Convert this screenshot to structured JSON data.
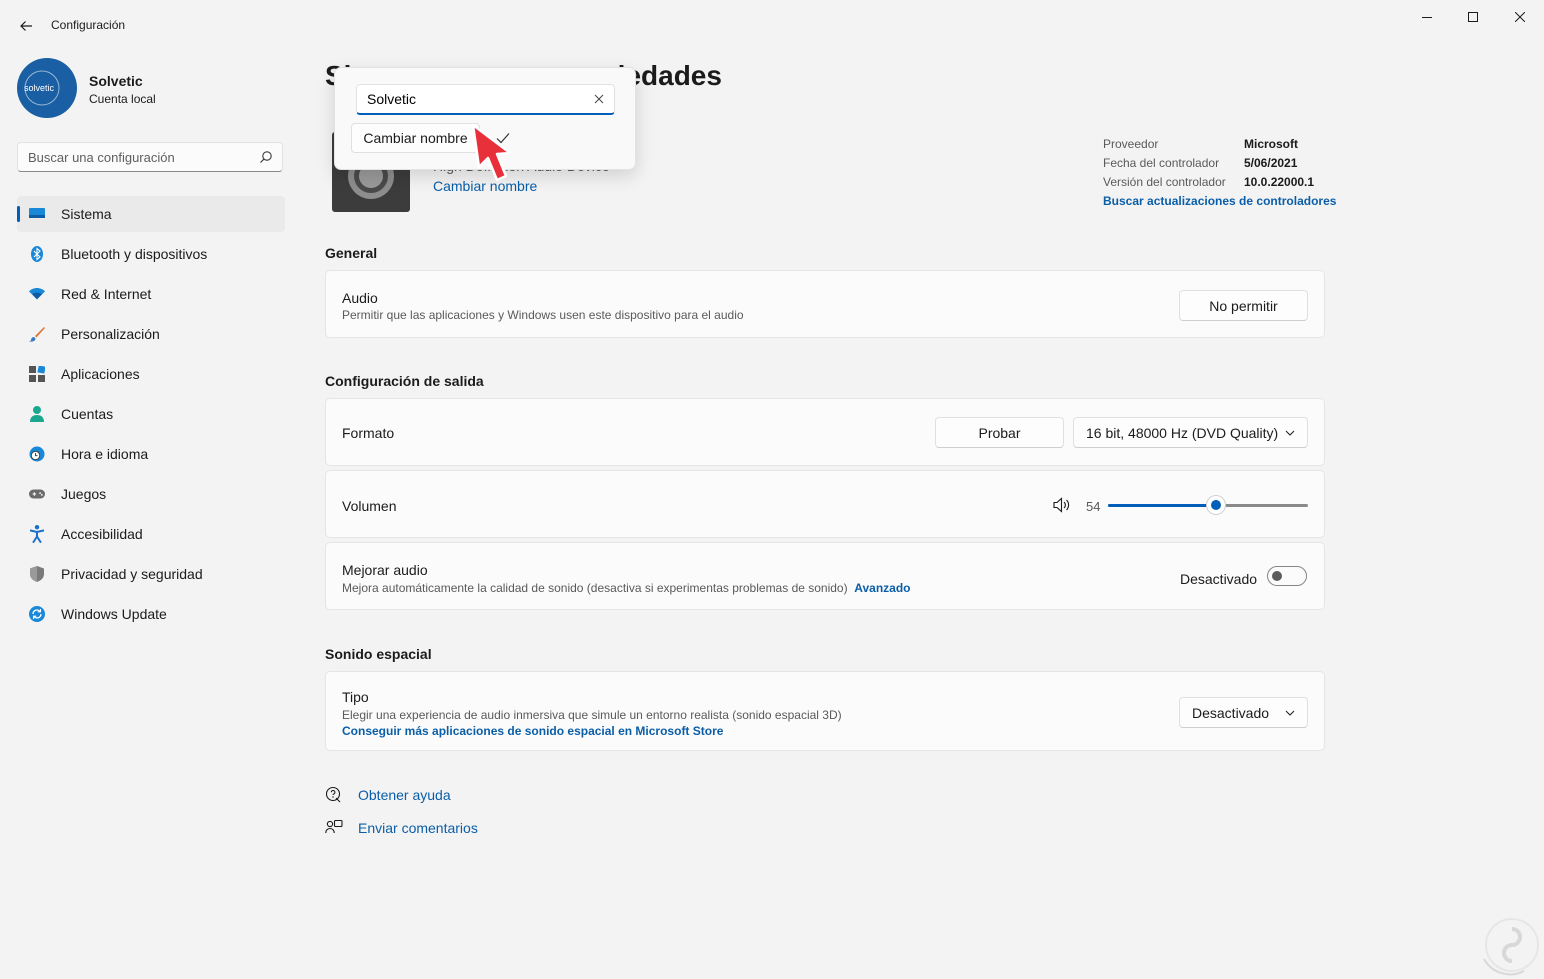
{
  "window": {
    "title": "Configuración"
  },
  "profile": {
    "avatar_text": "solvetic",
    "name": "Solvetic",
    "account_type": "Cuenta local"
  },
  "search": {
    "placeholder": "Buscar una configuración"
  },
  "sidebar": {
    "items": [
      {
        "label": "Sistema",
        "icon": "monitor-icon",
        "active": true
      },
      {
        "label": "Bluetooth y dispositivos",
        "icon": "bluetooth-icon"
      },
      {
        "label": "Red & Internet",
        "icon": "wifi-icon"
      },
      {
        "label": "Personalización",
        "icon": "brush-icon"
      },
      {
        "label": "Aplicaciones",
        "icon": "apps-icon"
      },
      {
        "label": "Cuentas",
        "icon": "person-icon"
      },
      {
        "label": "Hora e idioma",
        "icon": "globe-clock-icon"
      },
      {
        "label": "Juegos",
        "icon": "gamepad-icon"
      },
      {
        "label": "Accesibilidad",
        "icon": "accessibility-icon"
      },
      {
        "label": "Privacidad y seguridad",
        "icon": "shield-icon"
      },
      {
        "label": "Windows Update",
        "icon": "windows-update-icon"
      }
    ]
  },
  "page": {
    "title_left": "Si",
    "title_right": "opiedades"
  },
  "device": {
    "name": "High Definition Audio Device",
    "rename_link": "Cambiar nombre",
    "info": {
      "provider_label": "Proveedor",
      "provider_value": "Microsoft",
      "date_label": "Fecha del controlador",
      "date_value": "5/06/2021",
      "version_label": "Versión del controlador",
      "version_value": "10.0.22000.1"
    },
    "driver_update_link": "Buscar actualizaciones de controladores"
  },
  "general": {
    "heading": "General",
    "audio_title": "Audio",
    "audio_desc": "Permitir que las aplicaciones y Windows usen este dispositivo para el audio",
    "audio_button": "No permitir"
  },
  "output": {
    "heading": "Configuración de salida",
    "format_title": "Formato",
    "test_button": "Probar",
    "format_value": "16 bit, 48000 Hz (DVD Quality)",
    "volume_title": "Volumen",
    "volume_value": "54",
    "volume_percent": 54,
    "enhance_title": "Mejorar audio",
    "enhance_desc": "Mejora automáticamente la calidad de sonido (desactiva si experimentas problemas de sonido)",
    "enhance_link": "Avanzado",
    "enhance_state": "Desactivado",
    "enhance_on": false
  },
  "spatial": {
    "heading": "Sonido espacial",
    "type_title": "Tipo",
    "type_desc": "Elegir una experiencia de audio inmersiva que simule un entorno realista (sonido espacial 3D)",
    "store_link": "Conseguir más aplicaciones de sonido espacial en Microsoft Store",
    "type_value": "Desactivado"
  },
  "help": {
    "get_help": "Obtener ayuda",
    "feedback": "Enviar comentarios"
  },
  "rename_popup": {
    "input_value": "Solvetic",
    "button_label": "Cambiar nombre"
  },
  "colors": {
    "accent": "#005fb8",
    "link": "#0a5ea8",
    "background": "#f3f3f3",
    "card": "#fbfbfb",
    "pointer": "#e8303a"
  }
}
